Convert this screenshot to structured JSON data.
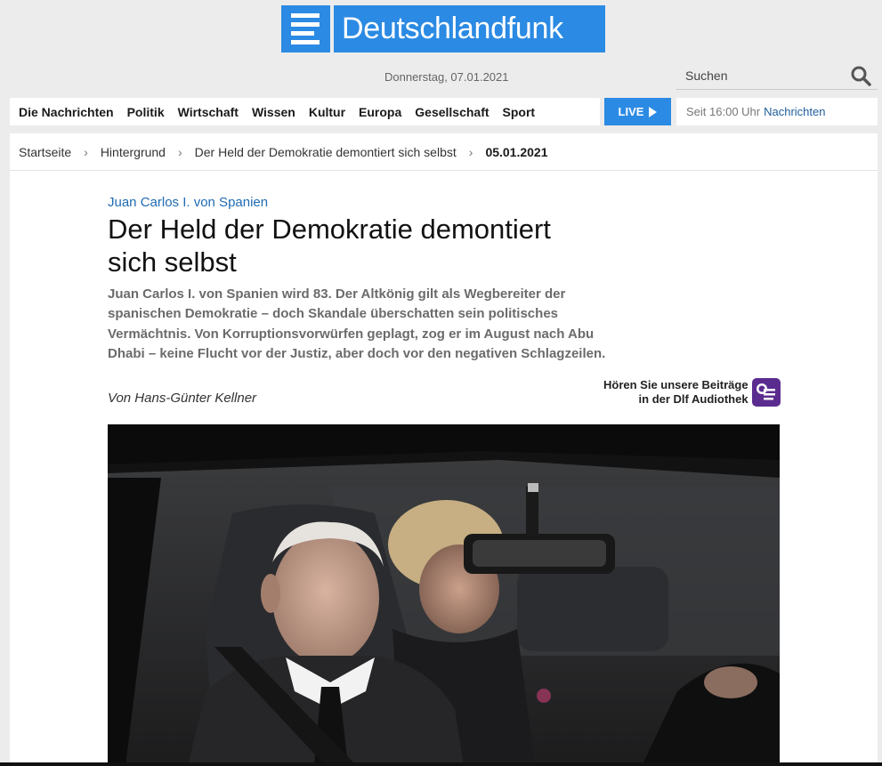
{
  "header": {
    "logo_text": "Deutschlandfunk",
    "date": "Donnerstag, 07.01.2021",
    "search_placeholder": "Suchen"
  },
  "nav": {
    "items": [
      "Die Nachrichten",
      "Politik",
      "Wirtschaft",
      "Wissen",
      "Kultur",
      "Europa",
      "Gesellschaft",
      "Sport"
    ],
    "live_label": "LIVE",
    "live_time": "Seit 16:00 Uhr",
    "live_program": "Nachrichten"
  },
  "breadcrumb": {
    "items": [
      "Startseite",
      "Hintergrund",
      "Der Held der Demokratie demontiert sich selbst"
    ],
    "current": "05.01.2021",
    "separator": "›"
  },
  "article": {
    "kicker": "Juan Carlos I. von Spanien",
    "headline": "Der Held der Demokratie demontiert sich selbst",
    "teaser": "Juan Carlos I. von Spanien wird 83. Der Altkönig gilt als Wegbereiter der spanischen Demokratie – doch Skandale überschatten sein politisches Vermächtnis. Von Korruptionsvorwürfen geplagt, zog er im August nach Abu Dhabi – keine Flucht vor der Justiz, aber doch vor den negativen Schlagzeilen.",
    "author": "Von Hans-Günter Kellner",
    "audiothek_line1": "Hören Sie unsere Beiträge",
    "audiothek_line2": "in der Dlf Audiothek"
  },
  "colors": {
    "brand_blue": "#2b8ae3",
    "kicker_blue": "#1f6bb3",
    "audiothek_purple": "#5b2c8f",
    "page_bg": "#ececec"
  },
  "icons": {
    "search": "search-icon",
    "live_play": "play-icon",
    "audiothek": "audiothek-icon"
  }
}
